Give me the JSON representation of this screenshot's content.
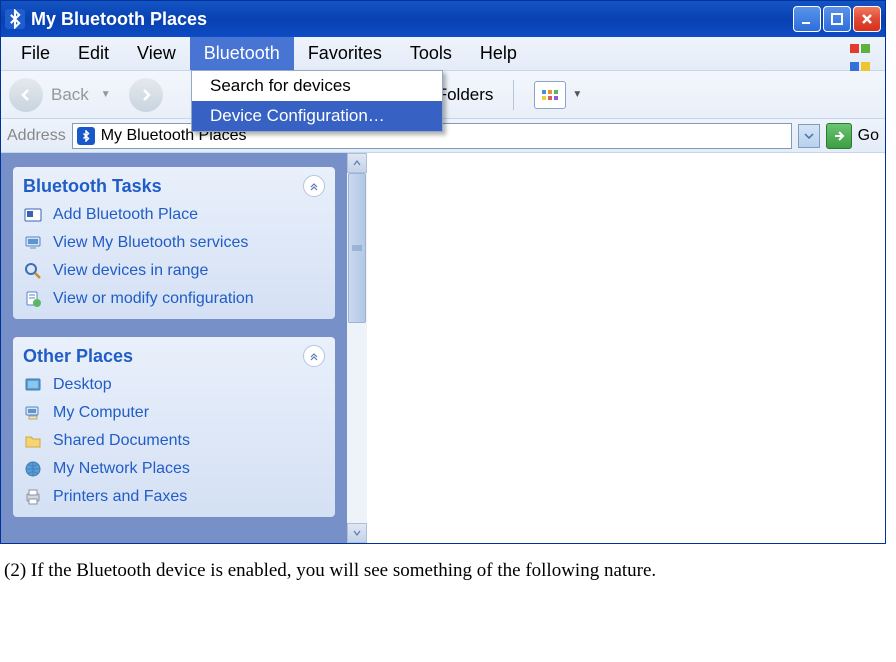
{
  "titlebar": {
    "title": "My Bluetooth Places"
  },
  "menubar": {
    "items": [
      "File",
      "Edit",
      "View",
      "Bluetooth",
      "Favorites",
      "Tools",
      "Help"
    ]
  },
  "dropdown": {
    "items": [
      "Search for devices",
      "Device Configuration…"
    ]
  },
  "toolbar": {
    "back_label": "Back",
    "folders_label": "Folders"
  },
  "addressbar": {
    "label": "Address",
    "location": "My Bluetooth Places",
    "go_label": "Go"
  },
  "sidebar": {
    "panels": [
      {
        "title": "Bluetooth Tasks",
        "items": [
          {
            "icon": "bluetooth-place-icon",
            "label": "Add Bluetooth Place"
          },
          {
            "icon": "computer-icon",
            "label": "View My Bluetooth services"
          },
          {
            "icon": "magnifier-icon",
            "label": "View devices in range"
          },
          {
            "icon": "config-icon",
            "label": "View or modify configuration"
          }
        ]
      },
      {
        "title": "Other Places",
        "items": [
          {
            "icon": "desktop-icon",
            "label": "Desktop"
          },
          {
            "icon": "my-computer-icon",
            "label": "My Computer"
          },
          {
            "icon": "folder-icon",
            "label": "Shared Documents"
          },
          {
            "icon": "network-places-icon",
            "label": "My Network Places"
          },
          {
            "icon": "printer-icon",
            "label": "Printers and Faxes"
          }
        ]
      }
    ]
  },
  "caption": "(2) If the Bluetooth device is enabled, you will see something of the following nature."
}
